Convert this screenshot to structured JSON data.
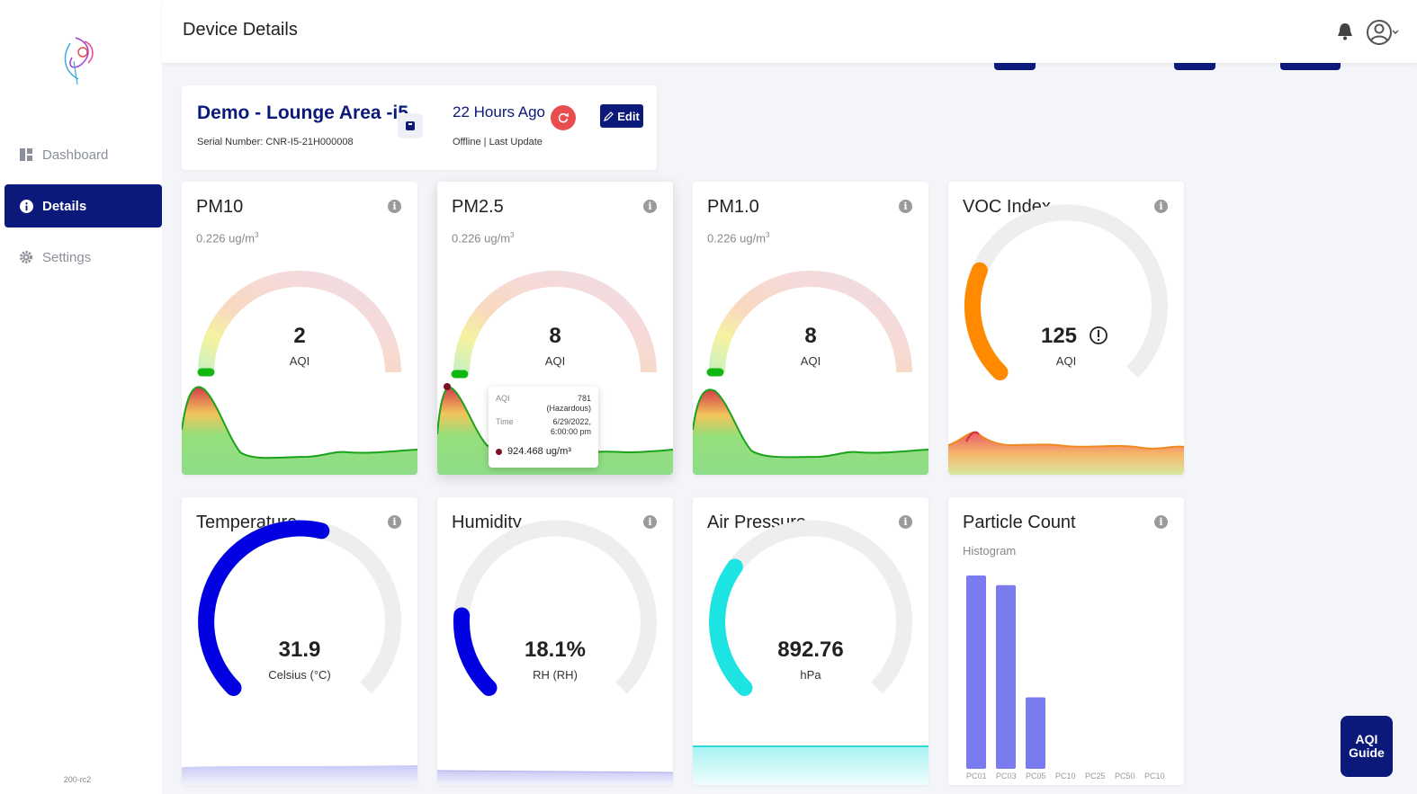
{
  "sidebar": {
    "items": [
      {
        "label": "Dashboard",
        "icon": "dashboard-icon",
        "active": false
      },
      {
        "label": "Details",
        "icon": "info-icon",
        "active": true
      },
      {
        "label": "Settings",
        "icon": "gear-icon",
        "active": false
      }
    ],
    "version": "200-rc2"
  },
  "header": {
    "title": "Device Details"
  },
  "device": {
    "name": "Demo - Lounge Area -i5",
    "serial": "Serial Number: CNR-I5-21H000008",
    "last_seen": "22 Hours Ago",
    "status": "Offline | Last Update",
    "edit_label": "Edit"
  },
  "cards": {
    "pm10": {
      "title": "PM10",
      "reading": "0.226 ug/m",
      "value": "2",
      "unit": "AQI"
    },
    "pm25": {
      "title": "PM2.5",
      "reading": "0.226 ug/m",
      "value": "8",
      "unit": "AQI"
    },
    "pm10b": {
      "title": "PM1.0",
      "reading": "0.226 ug/m",
      "value": "8",
      "unit": "AQI"
    },
    "voc": {
      "title": "VOC Index",
      "value": "125",
      "unit": "AQI",
      "fraction": 0.25
    },
    "temperature": {
      "title": "Temperature",
      "value": "31.9",
      "unit": "Celsius (°C)",
      "fraction": 0.55
    },
    "humidity": {
      "title": "Humidity",
      "value": "18.1%",
      "unit": "RH (RH)",
      "fraction": 0.181
    },
    "pressure": {
      "title": "Air Pressure",
      "value": "892.76",
      "unit": "hPa",
      "fraction": 0.3
    },
    "particle": {
      "title": "Particle Count",
      "subtitle": "Histogram",
      "labels": [
        "PC01",
        "PC03",
        "PC05",
        "PC10",
        "PC25",
        "PC50",
        "PC10"
      ],
      "values": [
        1.0,
        0.95,
        0.37,
        0,
        0,
        0,
        0
      ]
    }
  },
  "tooltip": {
    "aqi_label": "AQI",
    "aqi_value": "781",
    "aqi_category": "(Hazardous)",
    "time_label": "Time",
    "date": "6/29/2022,",
    "time": "6:00:00 pm",
    "reading": "924.468 ug/m³"
  },
  "aqi_guide": {
    "line1": "AQI",
    "line2": "Guide"
  },
  "colors": {
    "primary": "#0b1a7a",
    "alert": "#e94e4e",
    "voc": "#ff8a00",
    "temp": "#0000e0",
    "humidity": "#0000e0",
    "pressure": "#1ee3e3",
    "histogram": "#7b7bf0"
  }
}
